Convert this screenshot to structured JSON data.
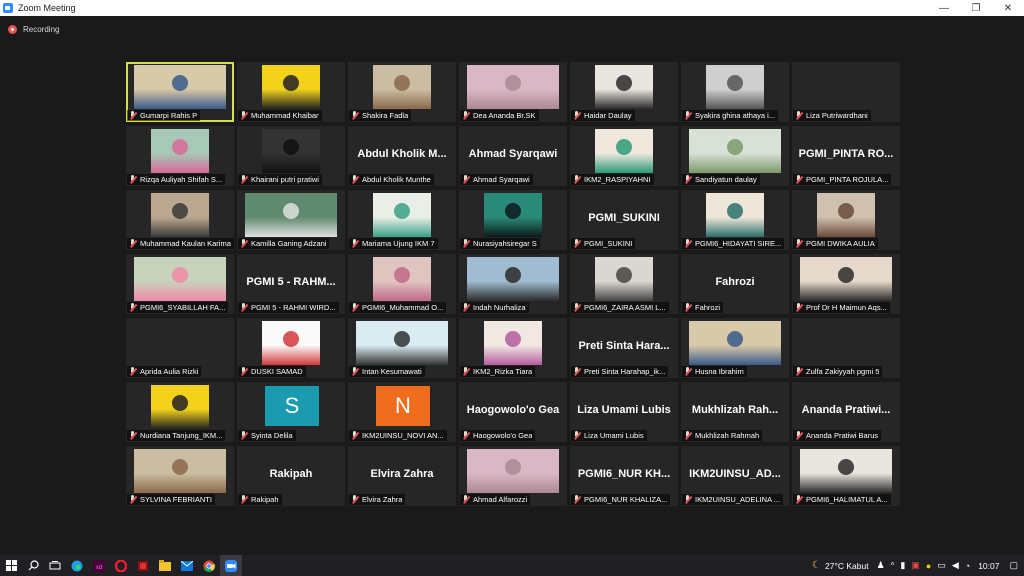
{
  "window": {
    "title": "Zoom Meeting",
    "minimize": "—",
    "maximize": "❐",
    "close": "✕"
  },
  "recording": {
    "label": "Recording"
  },
  "participants": [
    {
      "name": "Gumarpi Rahis P",
      "kind": "video",
      "active": true
    },
    {
      "name": "Muhammad Khaibar",
      "kind": "video"
    },
    {
      "name": "Shakira Fadla",
      "kind": "video"
    },
    {
      "name": "Dea Ananda Br.SK",
      "kind": "video"
    },
    {
      "name": "Haidar Daulay",
      "kind": "video"
    },
    {
      "name": "Syakira ghina athaya i...",
      "kind": "video"
    },
    {
      "name": "Liza Putriwardhani",
      "kind": "blank"
    },
    {
      "name": "Rizqa Auliyah Shifah S...",
      "kind": "video"
    },
    {
      "name": "Khairani putri pratiwi",
      "kind": "video"
    },
    {
      "name": "Abdul Kholik Munthe",
      "kind": "text",
      "big": "Abdul Kholik M..."
    },
    {
      "name": "Ahmad Syarqawi",
      "kind": "text",
      "big": "Ahmad Syarqawi"
    },
    {
      "name": "IKM2_RASPIYAHNI",
      "kind": "video"
    },
    {
      "name": "Sandiyatun daulay",
      "kind": "video"
    },
    {
      "name": "PGMI_PINTA ROJULA...",
      "kind": "text",
      "big": "PGMI_PINTA RO..."
    },
    {
      "name": "Muhammad Kaulan Karima",
      "kind": "video"
    },
    {
      "name": "Kamilla Ganing Adzani",
      "kind": "video"
    },
    {
      "name": "Mariama Ujung IKM 7",
      "kind": "video"
    },
    {
      "name": "Nurasiyahsiregar S",
      "kind": "video"
    },
    {
      "name": "PGMI_SUKINI",
      "kind": "text",
      "big": "PGMI_SUKINI"
    },
    {
      "name": "PGMI6_HIDAYATI SIRE...",
      "kind": "video"
    },
    {
      "name": "PGMI DWIKA AULIA",
      "kind": "video"
    },
    {
      "name": "PGMI6_SYABILLAH FA...",
      "kind": "video"
    },
    {
      "name": "PGMI 5 - RAHMI WIRD...",
      "kind": "text",
      "big": "PGMI 5 - RAHM..."
    },
    {
      "name": "PGMI6_Muhammad O...",
      "kind": "video"
    },
    {
      "name": "Indah Nurhaliza",
      "kind": "video"
    },
    {
      "name": "PGMI6_ZAIRA ASMI L...",
      "kind": "video"
    },
    {
      "name": "Fahrozi",
      "kind": "text",
      "big": "Fahrozi"
    },
    {
      "name": "Prof Dr H Maimun Aqs...",
      "kind": "video"
    },
    {
      "name": "Aprida Aulia Rizki",
      "kind": "blank"
    },
    {
      "name": "DUSKI SAMAD",
      "kind": "video"
    },
    {
      "name": "Intan Kesumawati",
      "kind": "video"
    },
    {
      "name": "IKM2_Rizka Tiara",
      "kind": "video"
    },
    {
      "name": "Preti Sinta Harahap_ik...",
      "kind": "text",
      "big": "Preti Sinta Hara..."
    },
    {
      "name": "Husna Ibrahim",
      "kind": "video"
    },
    {
      "name": "Zulfa Zakiyyah pgmi 5",
      "kind": "blank"
    },
    {
      "name": "Nurdiana Tanjung_IKM...",
      "kind": "video"
    },
    {
      "name": "Syinta Delila",
      "kind": "letter",
      "letter": "S"
    },
    {
      "name": "IKM2UINSU_NOVI AN...",
      "kind": "letter",
      "letter": "N"
    },
    {
      "name": "Haogowolo'o Gea",
      "kind": "text",
      "big": "Haogowolo'o Gea"
    },
    {
      "name": "Liza Umami Lubis",
      "kind": "text",
      "big": "Liza Umami Lubis"
    },
    {
      "name": "Mukhlizah Rahmah",
      "kind": "text",
      "big": "Mukhlizah Rah..."
    },
    {
      "name": "Ananda Pratiwi Barus",
      "kind": "text",
      "big": "Ananda Pratiwi..."
    },
    {
      "name": "SYLVINA FEBRIANTI",
      "kind": "video"
    },
    {
      "name": "Rakipah",
      "kind": "text",
      "big": "Rakipah"
    },
    {
      "name": "Elvira Zahra",
      "kind": "text",
      "big": "Elvira Zahra"
    },
    {
      "name": "Ahmad Alfarozzi",
      "kind": "video"
    },
    {
      "name": "PGMI6_NUR KHALIZA...",
      "kind": "text",
      "big": "PGMI6_NUR KH..."
    },
    {
      "name": "IKM2UINSU_ADELINA ...",
      "kind": "text",
      "big": "IKM2UINSU_AD..."
    },
    {
      "name": "PGMI6_HALIMATUL A...",
      "kind": "video"
    }
  ],
  "taskbar": {
    "weather": "27°C  Kabut",
    "time": "10:07"
  }
}
